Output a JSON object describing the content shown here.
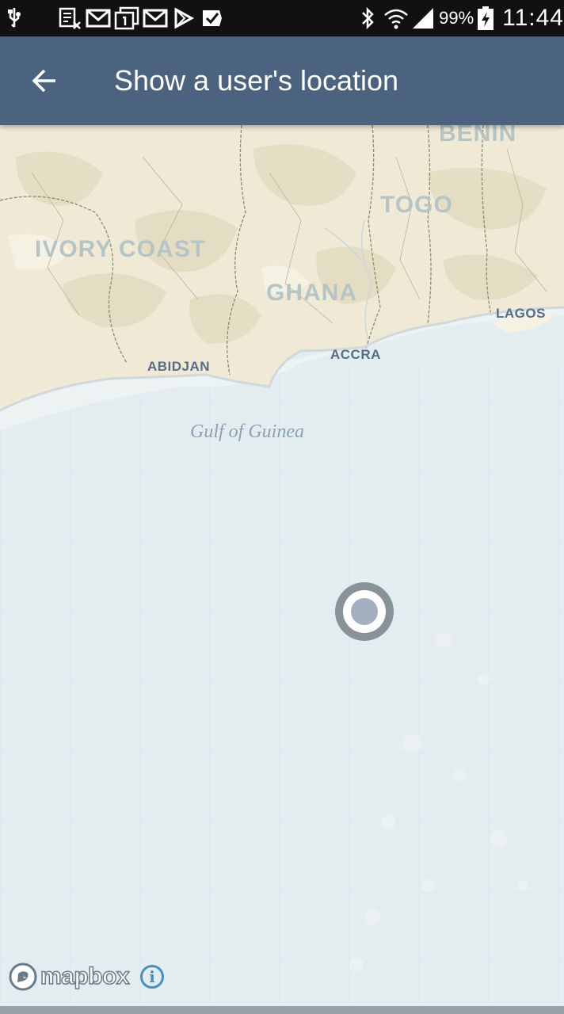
{
  "status_bar": {
    "battery": "99%",
    "time": "11:44",
    "icons": [
      "usb-icon",
      "screenshot-icon",
      "gmail-icon",
      "calendar-icon",
      "gmail-icon",
      "play-store-icon",
      "checkmark-icon",
      "bluetooth-icon",
      "wifi-icon",
      "signal-icon",
      "battery-charging-icon"
    ]
  },
  "app_bar": {
    "title": "Show a user's location",
    "back_icon": "arrow-back-icon"
  },
  "map": {
    "countries": {
      "benin": "BENIN",
      "togo": "TOGO",
      "ivory_coast": "IVORY COAST",
      "ghana": "GHANA"
    },
    "cities": {
      "lagos": "LAGOS",
      "accra": "ACCRA",
      "abidjan": "ABIDJAN"
    },
    "sea": "Gulf of Guinea",
    "attribution": {
      "logo_text": "mapbox",
      "info_label": "i"
    },
    "colors": {
      "land": "#efe9d6",
      "ocean": "#e3ecef",
      "app_bar": "#4c6380",
      "user_dot": "#a4b0c1"
    }
  }
}
